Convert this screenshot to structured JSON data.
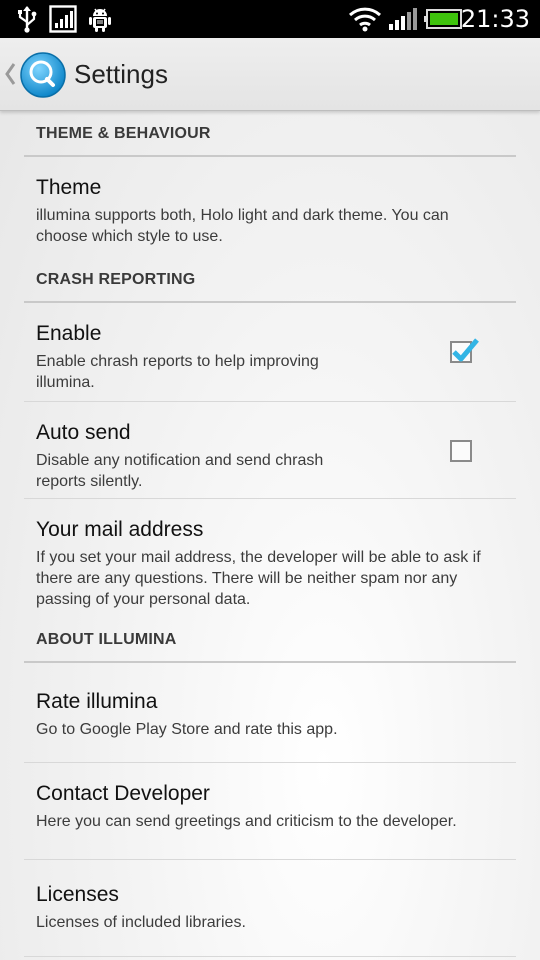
{
  "status_bar": {
    "time": "21:33",
    "icons": [
      "usb-icon",
      "signal-box-icon",
      "android-debug-icon",
      "wifi-icon",
      "cell-signal-icon",
      "battery-icon"
    ]
  },
  "action_bar": {
    "title": "Settings",
    "app_icon": "lightbulb-app-icon",
    "up_icon": "up-caret-icon"
  },
  "sections": {
    "theme": {
      "header": "THEME & BEHAVIOUR",
      "items": [
        {
          "title": "Theme",
          "summary": "illumina supports both, Holo light and dark theme. You can choose which style to use."
        }
      ]
    },
    "crash": {
      "header": "CRASH REPORTING",
      "items": [
        {
          "title": "Enable",
          "summary": "Enable chrash reports to help improving illumina.",
          "checked": true
        },
        {
          "title": "Auto send",
          "summary": "Disable any notification and send chrash reports silently.",
          "checked": false
        },
        {
          "title": "Your mail address",
          "summary": "If you set your mail address, the developer will be able to ask if there are any questions. There will be neither spam nor any passing of your personal data."
        }
      ]
    },
    "about": {
      "header": "ABOUT ILLUMINA",
      "items": [
        {
          "title": "Rate illumina",
          "summary": "Go to Google Play Store and rate this app."
        },
        {
          "title": "Contact Developer",
          "summary": "Here you can send greetings and criticism to the developer."
        },
        {
          "title": "Licenses",
          "summary": "Licenses of included libraries."
        }
      ]
    }
  },
  "colors": {
    "accent": "#33b5e5",
    "status_bar": "#000000",
    "action_bar": "#e9e9e9",
    "battery": "#3ec40c"
  }
}
